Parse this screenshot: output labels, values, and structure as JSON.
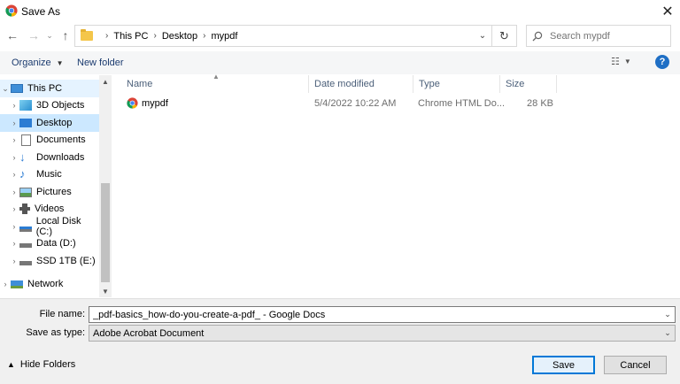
{
  "window": {
    "title": "Save As"
  },
  "address": {
    "breadcrumbs": [
      "This PC",
      "Desktop",
      "mypdf"
    ]
  },
  "search": {
    "placeholder": "Search mypdf"
  },
  "toolbar": {
    "organize_label": "Organize",
    "new_folder_label": "New folder"
  },
  "nav_pane": {
    "items": [
      {
        "label": "This PC",
        "icon": "computer-icon"
      },
      {
        "label": "3D Objects",
        "icon": "cube-icon"
      },
      {
        "label": "Desktop",
        "icon": "desktop-icon"
      },
      {
        "label": "Documents",
        "icon": "document-icon"
      },
      {
        "label": "Downloads",
        "icon": "download-icon"
      },
      {
        "label": "Music",
        "icon": "music-icon"
      },
      {
        "label": "Pictures",
        "icon": "picture-icon"
      },
      {
        "label": "Videos",
        "icon": "video-icon"
      },
      {
        "label": "Local Disk (C:)",
        "icon": "drive-icon"
      },
      {
        "label": "Data (D:)",
        "icon": "drive-icon"
      },
      {
        "label": "SSD 1TB (E:)",
        "icon": "drive-icon"
      },
      {
        "label": "Network",
        "icon": "network-icon"
      }
    ]
  },
  "file_list": {
    "columns": [
      "Name",
      "Date modified",
      "Type",
      "Size"
    ],
    "rows": [
      {
        "name": "mypdf",
        "date_modified": "5/4/2022 10:22 AM",
        "type": "Chrome HTML Do...",
        "size": "28 KB"
      }
    ]
  },
  "form": {
    "file_name_label": "File name:",
    "file_name_value": "_pdf-basics_how-do-you-create-a-pdf_ - Google Docs",
    "save_type_label": "Save as type:",
    "save_type_value": "Adobe Acrobat Document"
  },
  "footer": {
    "hide_folders_label": "Hide Folders",
    "save_label": "Save",
    "cancel_label": "Cancel"
  },
  "colors": {
    "accent": "#0078d7",
    "selected": "#cce8ff",
    "help": "#1f6fc5"
  }
}
